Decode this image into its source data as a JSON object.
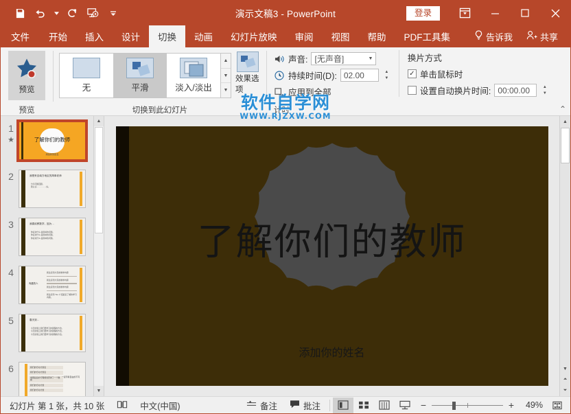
{
  "window": {
    "title": "演示文稿3  -  PowerPoint",
    "signin_label": "登录",
    "accent_color": "#b7472a"
  },
  "quick_access": [
    {
      "name": "save-icon",
      "tooltip": "保存"
    },
    {
      "name": "undo-icon",
      "tooltip": "撤消"
    },
    {
      "name": "redo-icon",
      "tooltip": "恢复"
    },
    {
      "name": "start-slideshow-icon",
      "tooltip": "从头开始"
    },
    {
      "name": "customize-qat-icon",
      "tooltip": "自定义快速访问工具栏"
    }
  ],
  "window_buttons": {
    "ribbon_display": "功能区显示选项",
    "minimize": "最小化",
    "maximize": "最大化",
    "close": "关闭"
  },
  "tabs": [
    {
      "label": "文件",
      "active": false
    },
    {
      "label": "开始",
      "active": false
    },
    {
      "label": "插入",
      "active": false
    },
    {
      "label": "设计",
      "active": false
    },
    {
      "label": "切换",
      "active": true
    },
    {
      "label": "动画",
      "active": false
    },
    {
      "label": "幻灯片放映",
      "active": false
    },
    {
      "label": "审阅",
      "active": false
    },
    {
      "label": "视图",
      "active": false
    },
    {
      "label": "帮助",
      "active": false
    },
    {
      "label": "PDF工具集",
      "active": false
    }
  ],
  "tellme_label": "告诉我",
  "share_label": "共享",
  "ribbon": {
    "preview_group": {
      "button_label": "预览",
      "group_label": "预览"
    },
    "transition_group": {
      "group_label": "切换到此幻灯片",
      "items": [
        {
          "label": "无",
          "selected": false
        },
        {
          "label": "平滑",
          "selected": true
        },
        {
          "label": "淡入/淡出",
          "selected": false
        }
      ],
      "effect_options_label": "效果选项"
    },
    "timing_group": {
      "group_label": "计时",
      "sound_label": "声音:",
      "sound_value": "[无声音]",
      "duration_label": "持续时间(D):",
      "duration_value": "02.00",
      "apply_all_label": "应用到全部",
      "advance_title": "换片方式",
      "on_click_label": "单击鼠标时",
      "on_click_checked": true,
      "auto_after_label": "设置自动换片时间:",
      "auto_after_checked": false,
      "auto_after_value": "00:00.00"
    },
    "collapse_label": "折叠功能区"
  },
  "thumbnails": [
    {
      "number": "1",
      "selected": true,
      "has_transition_star": true,
      "type": "title",
      "title": "了解你们的教师",
      "subtitle": "添加你的姓名"
    },
    {
      "number": "2",
      "selected": false,
      "has_transition_star": false,
      "type": "content",
      "heading": "我是来自南方地区的简单老师",
      "lines": [
        "分享问题回顾。",
        "我认识……………好。"
      ]
    },
    {
      "number": "3",
      "selected": false,
      "has_transition_star": false,
      "type": "content",
      "heading": "我喜欢教数学，因为…",
      "lines": [
        "你喜欢什么 最简单的问题。",
        "你喜欢什么 最简单的问题。",
        "你喜欢什么 最简单的问题。"
      ]
    },
    {
      "number": "4",
      "selected": false,
      "has_transition_star": false,
      "type": "content-right",
      "heading": "有趣的人",
      "lines": [
        "我注意到大家的教学内容",
        "我注意到大家的教学内容",
        "我注意到大家的教学内容",
        "我注意到 Tee 介绍最近了解的学习内容。"
      ]
    },
    {
      "number": "5",
      "selected": false,
      "has_transition_star": false,
      "type": "content",
      "heading": "春天到…",
      "lines": [
        "今天的课上我们要学习的课程的方法。",
        "今天的课上我们要学习的课程的方法。",
        "今天的课上我们要学习的课程的方法。"
      ]
    },
    {
      "number": "6",
      "selected": false,
      "has_transition_star": false,
      "type": "table",
      "heading": "列表内容展示",
      "lines": [
        "我们的行动计划表",
        "我们的行动计划表",
        "学期最后的行程规划安排了一个数据",
        "我们的行动计划",
        "我们的行动计划"
      ],
      "sidenote": "一起带着自由的不同"
    }
  ],
  "slide": {
    "title": "了解你们的教师",
    "subtitle": "添加你的姓名",
    "background_color": "#3d2d08",
    "shape_color": "#4a4a4a",
    "stripe_color": "#110c02"
  },
  "watermark": {
    "main": "软件自学网",
    "url": "WWW.RJZXW.COM",
    "color": "#2b8fd6"
  },
  "status_bar": {
    "slide_count": "幻灯片 第 1 张，共 10 张",
    "language": "中文(中国)",
    "notes_label": "备注",
    "comments_label": "批注",
    "views": [
      {
        "name": "normal-view",
        "active": true
      },
      {
        "name": "slide-sorter-view",
        "active": false
      },
      {
        "name": "reading-view",
        "active": false
      },
      {
        "name": "slideshow-view",
        "active": false
      }
    ],
    "zoom_out": "−",
    "zoom_in": "+",
    "zoom_level": "49%",
    "fit_label": "使幻灯片适应当前窗口"
  }
}
